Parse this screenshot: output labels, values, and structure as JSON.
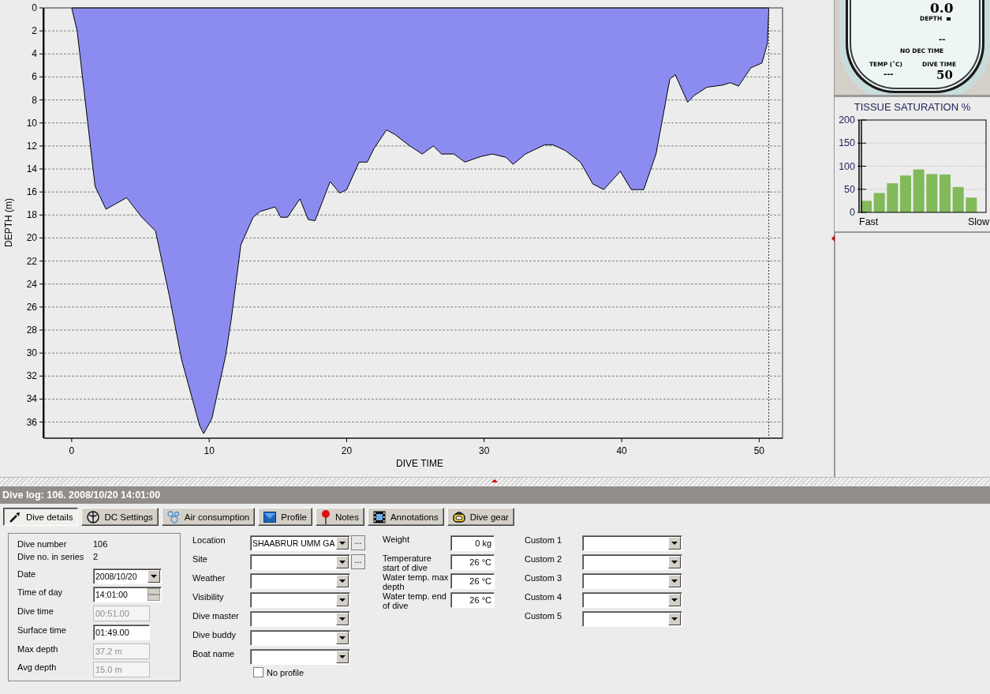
{
  "dive_profile": {
    "chart_data": {
      "type": "area",
      "xlabel": "DIVE TIME",
      "ylabel": "DEPTH (m)",
      "grid": true,
      "xlim": [
        -2,
        51.7
      ],
      "ylim": [
        37.4,
        0
      ],
      "xticks": [
        0,
        10,
        20,
        30,
        40,
        50
      ],
      "yticks": [
        0,
        2,
        4,
        6,
        8,
        10,
        12,
        14,
        16,
        18,
        20,
        22,
        24,
        26,
        28,
        30,
        32,
        34,
        36
      ],
      "ref_lines": [
        {
          "axis": "x",
          "value": 50.7
        }
      ],
      "x": [
        0,
        0.4,
        1.7,
        2.5,
        4,
        5.1,
        6.1,
        7.1,
        8,
        9.3,
        9.6,
        10.2,
        11.2,
        11.6,
        12.3,
        13.2,
        13.7,
        14.8,
        15.2,
        15.7,
        16.6,
        17.2,
        17.7,
        18.8,
        19.5,
        20,
        20.9,
        21.5,
        22,
        22.9,
        23.5,
        24.6,
        25.5,
        26.3,
        26.9,
        27.8,
        28.6,
        29.8,
        30.6,
        31.6,
        32.1,
        33,
        34.4,
        35,
        35.9,
        37,
        37.9,
        38.7,
        39.9,
        40.7,
        41.6,
        42.5,
        43.5,
        43.9,
        44.8,
        45.3,
        46.2,
        47.4,
        47.9,
        48.5,
        49.4,
        50.2,
        50.6,
        50.7
      ],
      "series": [
        {
          "color": "#8c8cf0",
          "values": [
            0,
            2,
            15.5,
            17.5,
            16.5,
            18.2,
            19.4,
            25,
            30.6,
            36.3,
            37,
            35.7,
            30.2,
            27.1,
            20.6,
            18.2,
            17.7,
            17.3,
            18.2,
            18.2,
            16.6,
            18.4,
            18.5,
            15.1,
            16.1,
            15.8,
            13.4,
            13.4,
            12.2,
            10.6,
            11,
            12,
            12.7,
            12,
            12.7,
            12.7,
            13.4,
            12.9,
            12.7,
            13,
            13.6,
            12.7,
            11.9,
            11.9,
            12.4,
            13.4,
            15.3,
            15.8,
            14.2,
            15.8,
            15.8,
            12.7,
            6.2,
            5.8,
            8.2,
            7.6,
            6.9,
            6.7,
            6.5,
            6.8,
            5.2,
            4.8,
            3.1,
            0
          ]
        }
      ]
    }
  },
  "dive_computer": {
    "depth": "0.0",
    "depth_label": "DEPTH",
    "no_dec_time": "--",
    "no_dec_label": "NO DEC TIME",
    "temp_label": "TEMP (˚C)",
    "temp": "---",
    "dive_time_label": "DIVE TIME",
    "dive_time": "50"
  },
  "tissue_saturation": {
    "chart_data": {
      "type": "bar",
      "title": "TISSUE SATURATION %",
      "grid": true,
      "categories": [
        "Fast",
        null,
        null,
        null,
        null,
        null,
        null,
        null,
        "Slow"
      ],
      "ylim": [
        0,
        200
      ],
      "yticks": [
        0,
        50,
        100,
        150,
        200
      ],
      "series": [
        {
          "color": "#82b95a",
          "values": [
            25,
            42,
            63,
            80,
            93,
            83,
            82,
            55,
            32
          ]
        }
      ]
    }
  },
  "log_title": "Dive log: 106. 2008/10/20 14:01:00",
  "tabs": [
    {
      "label": "Dive details",
      "selected": true
    },
    {
      "label": "DC Settings",
      "selected": false
    },
    {
      "label": "Air consumption",
      "selected": false
    },
    {
      "label": "Profile",
      "selected": false
    },
    {
      "label": "Notes",
      "selected": false
    },
    {
      "label": "Annotations",
      "selected": false
    },
    {
      "label": "Dive gear",
      "selected": false
    }
  ],
  "summary": [
    {
      "label": "Dive number",
      "value": "106",
      "kind": "static"
    },
    {
      "label": "Dive no. in series",
      "value": "2",
      "kind": "static"
    },
    {
      "label": "Date",
      "value": "2008/10/20",
      "kind": "date"
    },
    {
      "label": "Time of day",
      "value": "14:01:00",
      "kind": "time"
    },
    {
      "label": "Dive time",
      "value": "00:51.00",
      "kind": "field",
      "disabled": true
    },
    {
      "label": "Surface time",
      "value": "01:49.00",
      "kind": "field",
      "disabled": false
    },
    {
      "label": "Max depth",
      "value": "37.2 m",
      "kind": "field",
      "disabled": true
    },
    {
      "label": "Avg depth",
      "value": "15.0 m",
      "kind": "field",
      "disabled": true
    }
  ],
  "details": [
    {
      "label": "Location",
      "value": "SHAABRUR UMM GA",
      "button": "..."
    },
    {
      "label": "Site",
      "button": "..."
    },
    {
      "label": "Weather"
    },
    {
      "label": "Visibility"
    },
    {
      "label": "Dive master"
    },
    {
      "label": "Dive buddy"
    },
    {
      "label": "Boat name"
    }
  ],
  "no_profile": {
    "label": "No profile",
    "checked": false
  },
  "measurements": [
    {
      "label": "Weight",
      "value": "0 kg"
    },
    {
      "label": "Temperature start of dive",
      "value": "26 °C"
    },
    {
      "label": "Water temp. max depth",
      "value": "26 °C"
    },
    {
      "label": "Water temp. end of dive",
      "value": "26 °C"
    }
  ],
  "custom": [
    {
      "label": "Custom 1"
    },
    {
      "label": "Custom 2"
    },
    {
      "label": "Custom 3"
    },
    {
      "label": "Custom 4"
    },
    {
      "label": "Custom 5"
    }
  ]
}
